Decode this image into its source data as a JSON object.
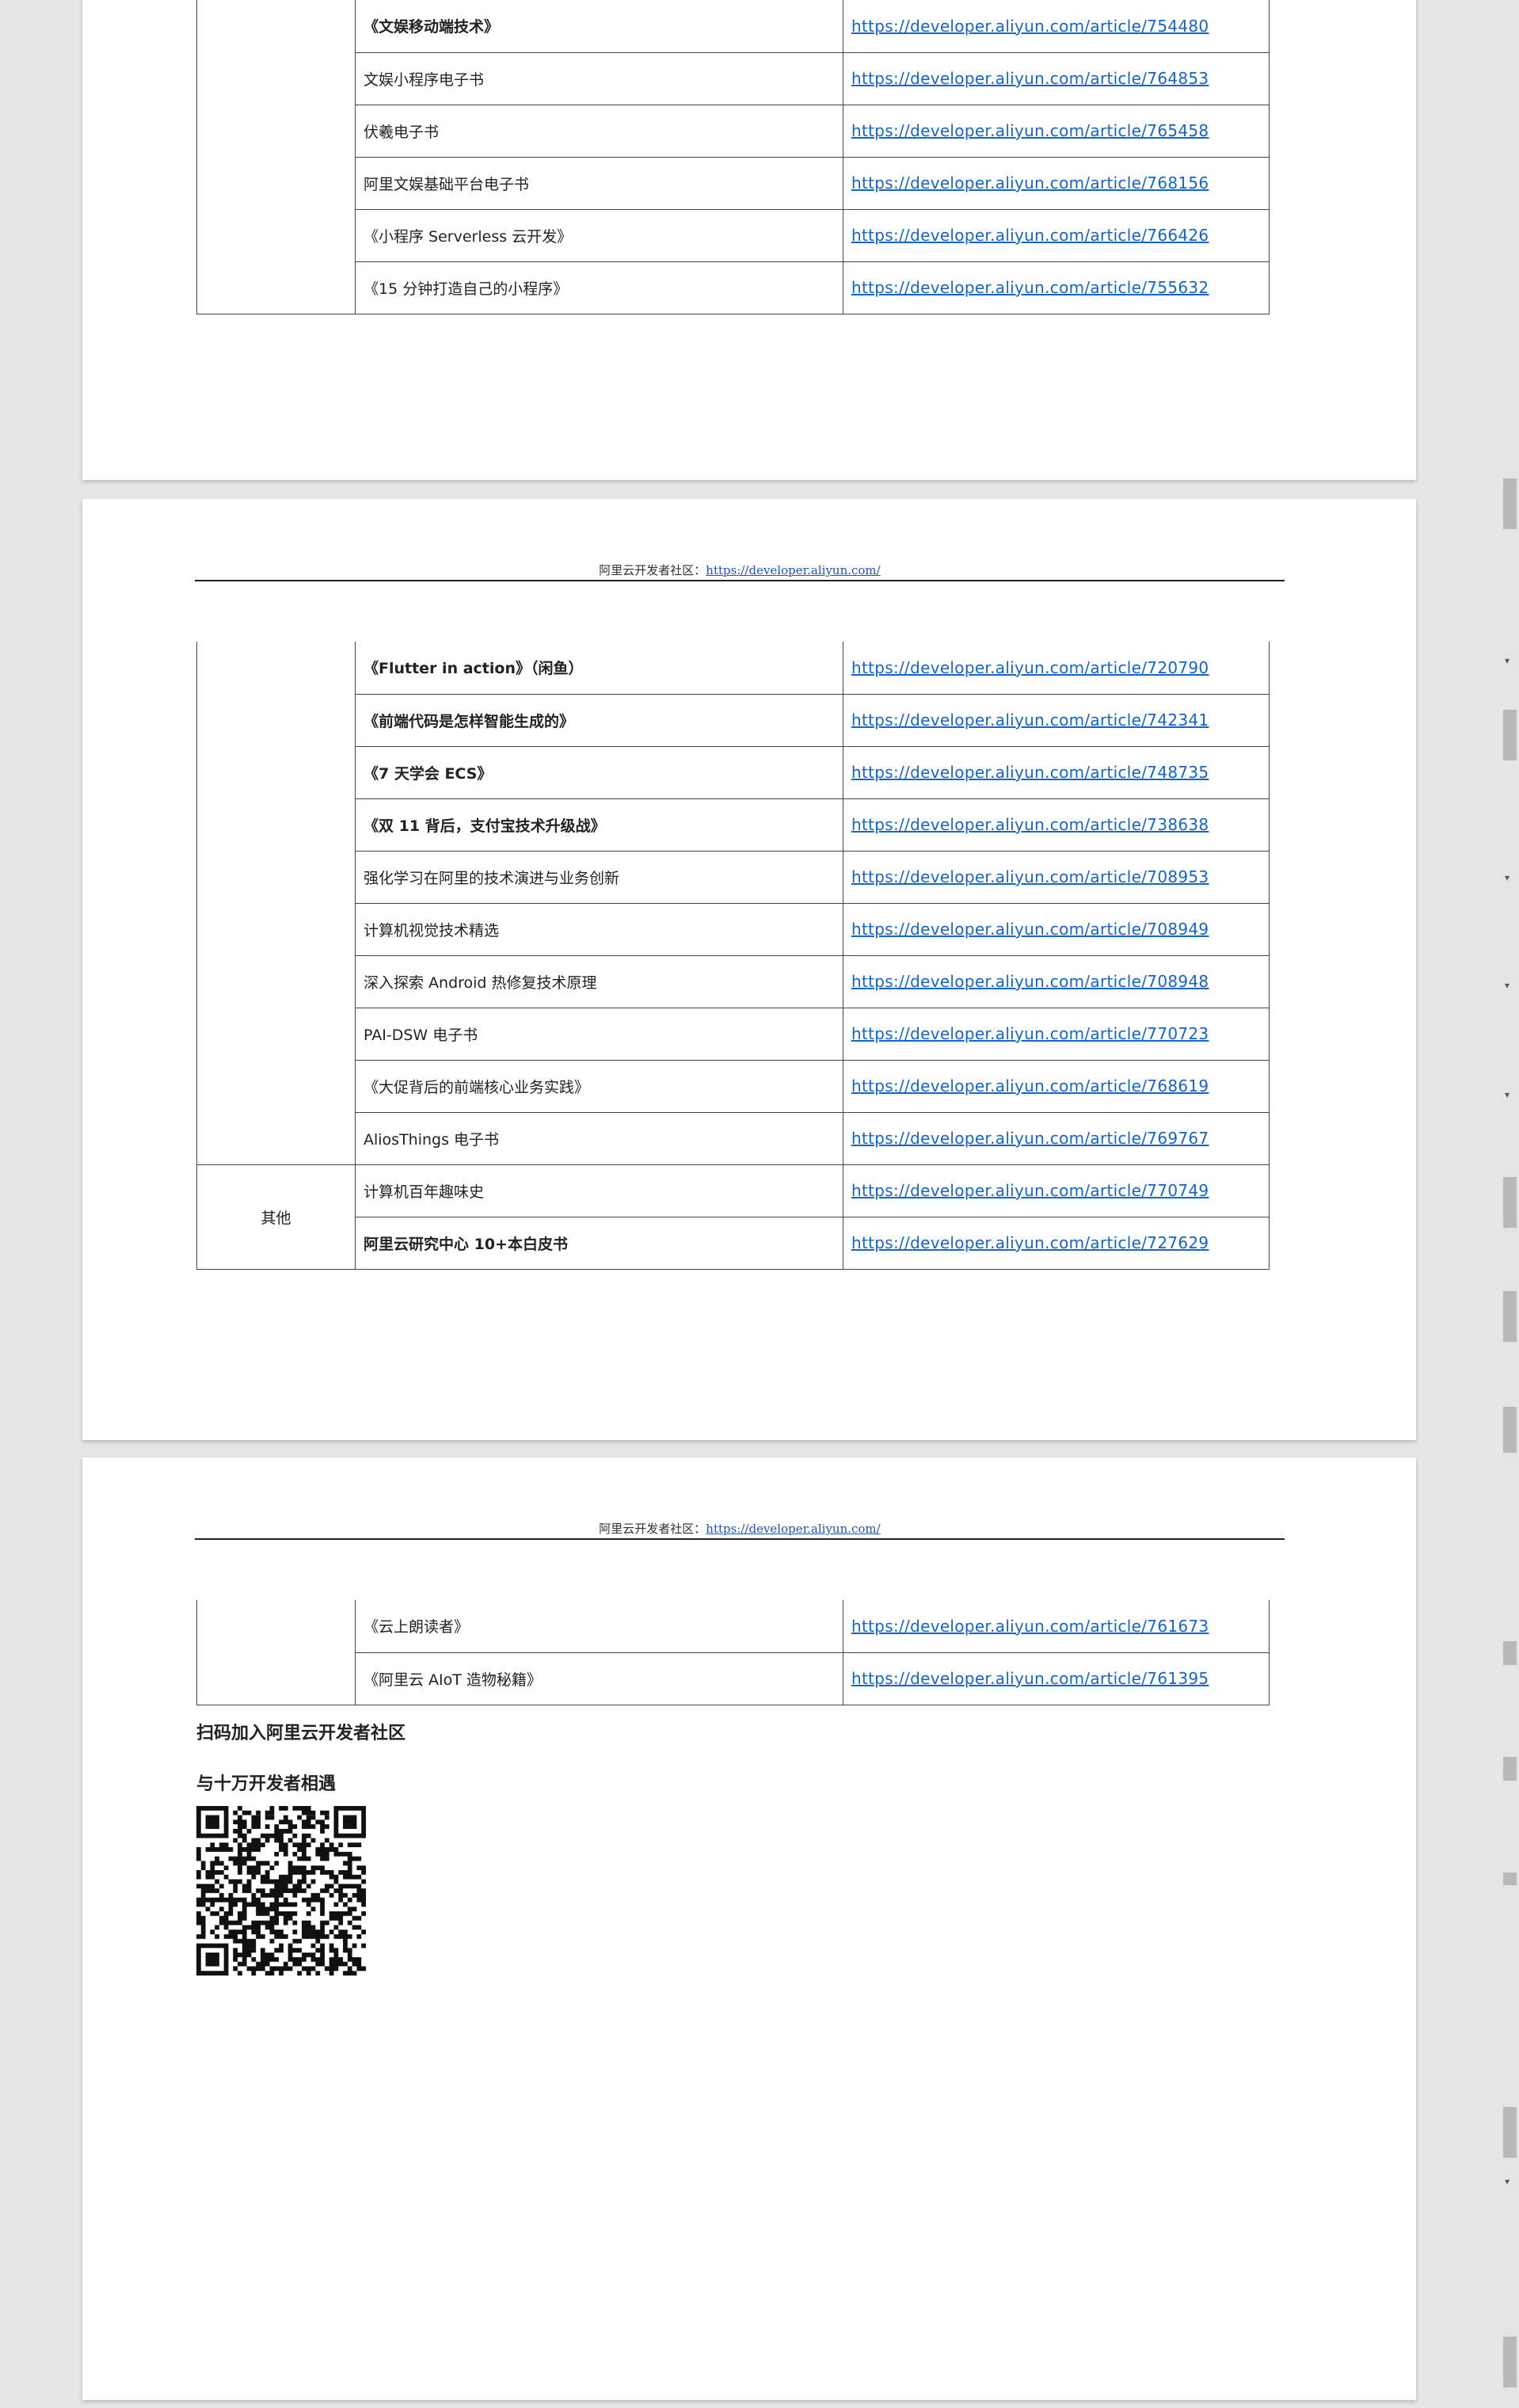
{
  "header": {
    "prefix": "阿里云开发者社区：",
    "link": "https://developer.aliyun.com/"
  },
  "page1": {
    "rows": [
      {
        "title": "《文娱移动端技术》",
        "url": "https://developer.aliyun.com/article/754480",
        "bold": true
      },
      {
        "title": "文娱小程序电子书",
        "url": "https://developer.aliyun.com/article/764853",
        "bold": false
      },
      {
        "title": "伏羲电子书",
        "url": "https://developer.aliyun.com/article/765458",
        "bold": false
      },
      {
        "title": "阿里文娱基础平台电子书",
        "url": "https://developer.aliyun.com/article/768156",
        "bold": false
      },
      {
        "title": "《小程序 Serverless  云开发》",
        "url": "https://developer.aliyun.com/article/766426",
        "bold": false
      },
      {
        "title": "《15 分钟打造自己的小程序》",
        "url": "https://developer.aliyun.com/article/755632",
        "bold": false
      }
    ]
  },
  "page2": {
    "rows": [
      {
        "title": "《Flutter in action》（闲鱼）",
        "url": "https://developer.aliyun.com/article/720790",
        "bold": true
      },
      {
        "title": "《前端代码是怎样智能生成的》",
        "url": "https://developer.aliyun.com/article/742341",
        "bold": true
      },
      {
        "title": "《7 天学会 ECS》",
        "url": "https://developer.aliyun.com/article/748735",
        "bold": true
      },
      {
        "title": "《双 11 背后，支付宝技术升级战》",
        "url": "https://developer.aliyun.com/article/738638",
        "bold": true
      },
      {
        "title": "强化学习在阿里的技术演进与业务创新",
        "url": "https://developer.aliyun.com/article/708953",
        "bold": false
      },
      {
        "title": "计算机视觉技术精选",
        "url": "https://developer.aliyun.com/article/708949",
        "bold": false
      },
      {
        "title": "深入探索 Android 热修复技术原理",
        "url": "https://developer.aliyun.com/article/708948",
        "bold": false
      },
      {
        "title": "PAI-DSW 电子书",
        "url": "https://developer.aliyun.com/article/770723",
        "bold": false
      },
      {
        "title": "《大促背后的前端核心业务实践》",
        "url": "https://developer.aliyun.com/article/768619",
        "bold": false
      },
      {
        "title": "AliosThings 电子书",
        "url": "https://developer.aliyun.com/article/769767",
        "bold": false
      }
    ],
    "other_category": "其他",
    "other_rows": [
      {
        "title": "计算机百年趣味史",
        "url": "https://developer.aliyun.com/article/770749",
        "bold": false
      },
      {
        "title": "阿里云研究中心 10+本白皮书",
        "url": "https://developer.aliyun.com/article/727629",
        "bold": true
      }
    ]
  },
  "page3": {
    "rows": [
      {
        "title": "《云上朗读者》",
        "url": "https://developer.aliyun.com/article/761673",
        "bold": false
      },
      {
        "title": "《阿里云 AIoT 造物秘籍》",
        "url": "https://developer.aliyun.com/article/761395",
        "bold": false
      }
    ],
    "closing_line1": "扫码加入阿里云开发者社区",
    "closing_line2": "与十万开发者相遇"
  },
  "icons": {
    "qr": "qr-code-icon",
    "scroll_down": "scroll-down-arrow-icon"
  },
  "colors": {
    "link": "#1565c8",
    "page": "#ffffff",
    "background": "#e6e6e6"
  }
}
